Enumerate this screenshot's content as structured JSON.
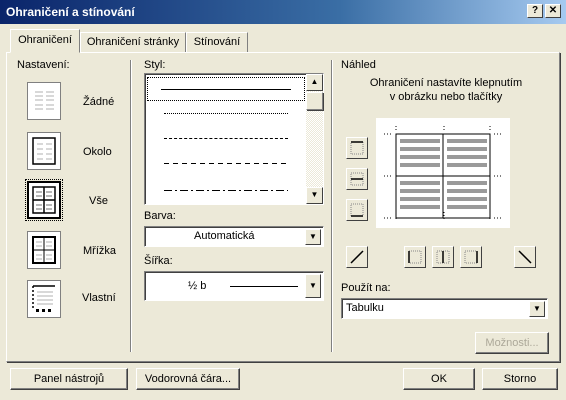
{
  "window": {
    "title": "Ohraničení a stínování",
    "help_btn": "?",
    "close_btn": "✕"
  },
  "tabs": [
    {
      "label": "Ohraničení",
      "active": true
    },
    {
      "label": "Ohraničení stránky",
      "active": false
    },
    {
      "label": "Stínování",
      "active": false
    }
  ],
  "settings": {
    "header": "Nastavení:",
    "items": [
      {
        "label": "Žádné",
        "icon": "border-none-icon",
        "selected": false
      },
      {
        "label": "Okolo",
        "icon": "border-box-icon",
        "selected": false
      },
      {
        "label": "Vše",
        "icon": "border-all-icon",
        "selected": true
      },
      {
        "label": "Mřížka",
        "icon": "border-grid-icon",
        "selected": false
      },
      {
        "label": "Vlastní",
        "icon": "border-custom-icon",
        "selected": false
      }
    ]
  },
  "style": {
    "header": "Styl:",
    "line_styles": [
      "solid",
      "dotted",
      "dashed-fine",
      "dashed",
      "dash-dot"
    ]
  },
  "color": {
    "label": "Barva:",
    "value": "Automatická"
  },
  "width": {
    "label": "Šířka:",
    "value": "½ b"
  },
  "preview": {
    "header": "Náhled",
    "instructions_line1": "Ohraničení nastavíte klepnutím",
    "instructions_line2": "v obrázku nebo tlačítky"
  },
  "apply_to": {
    "label": "Použít na:",
    "value": "Tabulku"
  },
  "buttons": {
    "options": "Možnosti...",
    "toolbar": "Panel nástrojů",
    "horizontal_line": "Vodorovná čára...",
    "ok": "OK",
    "cancel": "Storno"
  },
  "colors": {
    "title_start": "#0a246a",
    "title_end": "#a6caf0",
    "face": "#ece9d8"
  }
}
